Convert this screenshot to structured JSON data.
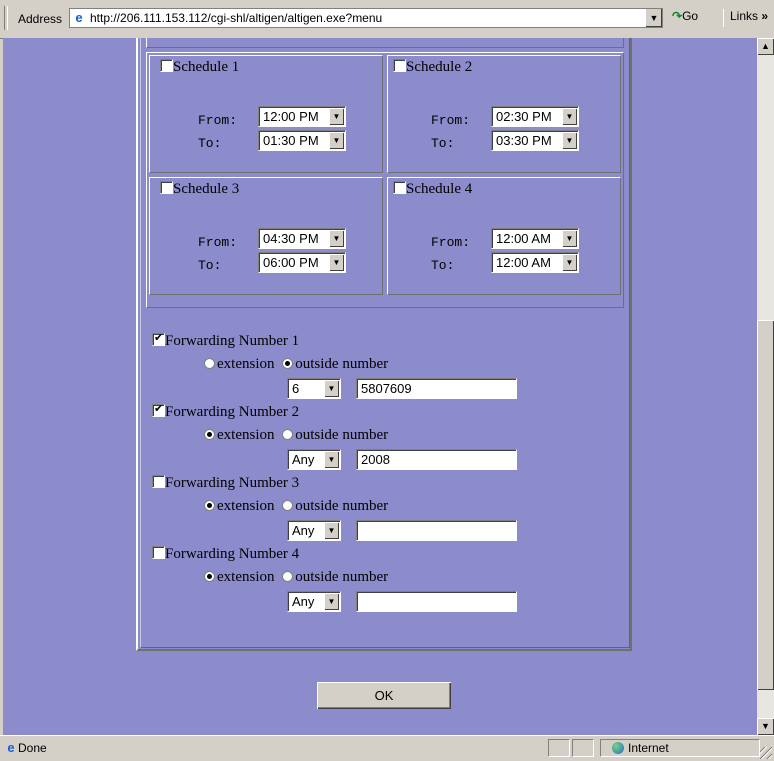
{
  "toolbar": {
    "address_label": "Address",
    "url": "http://206.111.153.112/cgi-shl/altigen/altigen.exe?menu",
    "go_label": "Go",
    "links_label": "Links"
  },
  "schedules": [
    {
      "label": "Schedule 1",
      "checked": false,
      "from_label": "From:",
      "to_label": "To:",
      "from": "12:00 PM",
      "to": "01:30 PM"
    },
    {
      "label": "Schedule 2",
      "checked": false,
      "from_label": "From:",
      "to_label": "To:",
      "from": "02:30 PM",
      "to": "03:30 PM"
    },
    {
      "label": "Schedule 3",
      "checked": false,
      "from_label": "From:",
      "to_label": "To:",
      "from": "04:30 PM",
      "to": "06:00 PM"
    },
    {
      "label": "Schedule 4",
      "checked": false,
      "from_label": "From:",
      "to_label": "To:",
      "from": "12:00 AM",
      "to": "12:00 AM"
    }
  ],
  "forwarding": [
    {
      "label": "Forwarding Number 1",
      "checked": true,
      "ext_label": "extension",
      "outside_label": "outside number",
      "mode": "outside",
      "prefix": "6",
      "number": "5807609"
    },
    {
      "label": "Forwarding Number 2",
      "checked": true,
      "ext_label": "extension",
      "outside_label": "outside number",
      "mode": "extension",
      "prefix": "Any",
      "number": "2008"
    },
    {
      "label": "Forwarding Number 3",
      "checked": false,
      "ext_label": "extension",
      "outside_label": "outside number",
      "mode": "extension",
      "prefix": "Any",
      "number": ""
    },
    {
      "label": "Forwarding Number 4",
      "checked": false,
      "ext_label": "extension",
      "outside_label": "outside number",
      "mode": "extension",
      "prefix": "Any",
      "number": ""
    }
  ],
  "ok_label": "OK",
  "status": {
    "text": "Done",
    "zone": "Internet"
  },
  "colors": {
    "page_bg": "#8c8ccc",
    "chrome": "#d4d0c8"
  }
}
